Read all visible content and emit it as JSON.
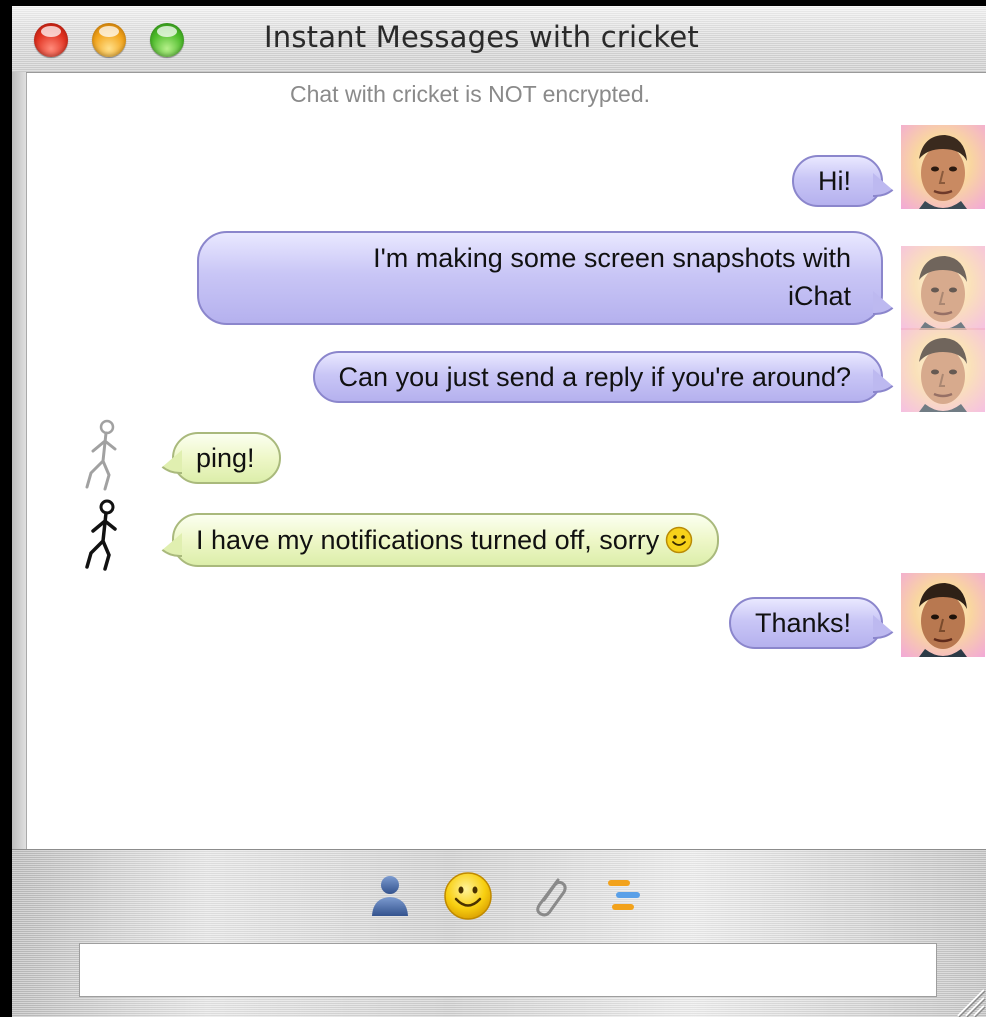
{
  "window": {
    "title": "Instant Messages with cricket"
  },
  "chat": {
    "encryption_notice": "Chat with cricket is NOT encrypted.",
    "messages": [
      {
        "sender": "me",
        "text": "Hi!"
      },
      {
        "sender": "me",
        "line1": "I'm making some screen snapshots with",
        "line2": "iChat"
      },
      {
        "sender": "me",
        "text": "Can you just send a reply if you're around?"
      },
      {
        "sender": "cricket",
        "text": "ping!"
      },
      {
        "sender": "cricket",
        "text": "I have my notifications turned off, sorry",
        "emoticon": "smiley-icon"
      },
      {
        "sender": "me",
        "text": "Thanks!"
      }
    ]
  },
  "toolbar": {
    "icons": [
      "buddy-icon",
      "smiley-icon",
      "paperclip-icon",
      "text-format-icon"
    ]
  },
  "input": {
    "value": "",
    "placeholder": ""
  },
  "colors": {
    "outgoing_bubble": "#c9c6f6",
    "incoming_bubble": "#eef7c8",
    "close_button": "#e0301e",
    "minimize_button": "#f2a31a",
    "zoom_button": "#4cbb2a"
  }
}
